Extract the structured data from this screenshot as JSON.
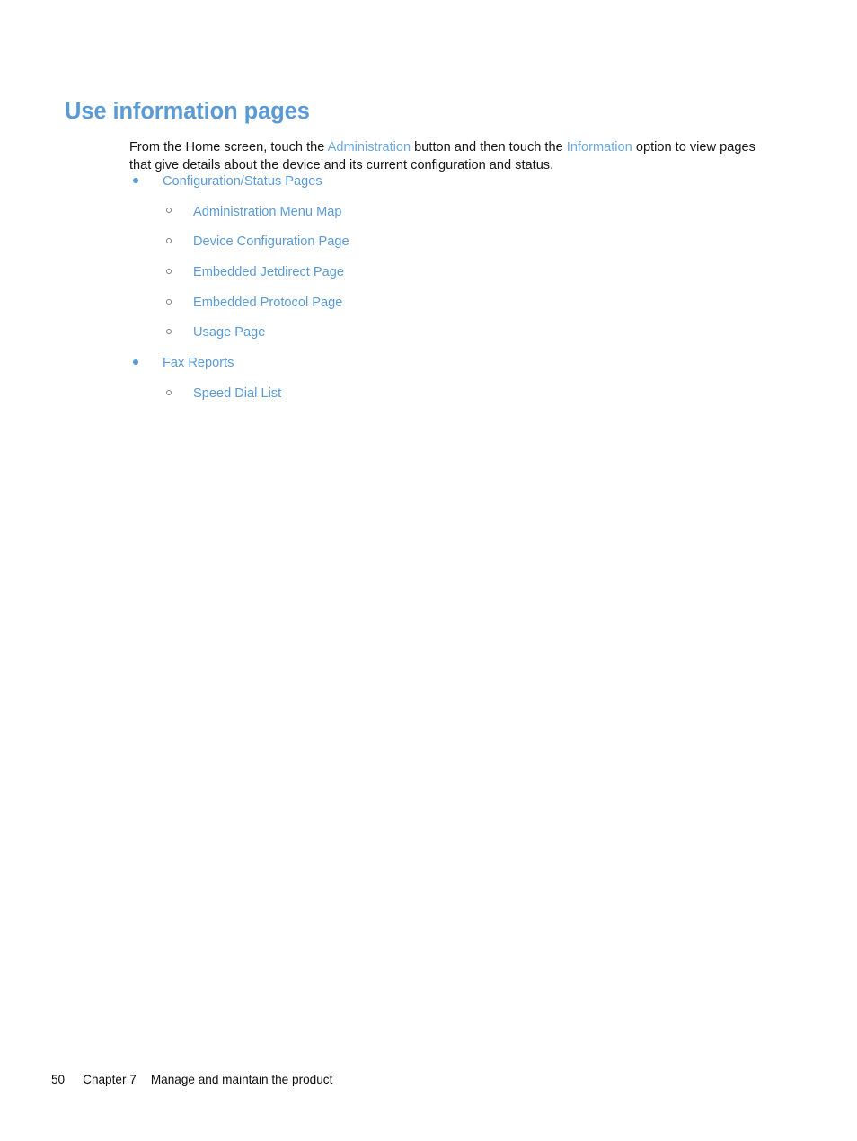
{
  "document": {
    "heading": "Use information pages",
    "intro": {
      "part1": "From the Home screen, touch the ",
      "link1": "Administration",
      "part2": " button and then touch the ",
      "link2": "Information",
      "part3": " option to view pages that give details about the device and its current configuration and status."
    },
    "colors": {
      "heading_blue": "#5b9bd5",
      "link_blue": "#5b9bd5",
      "inline_link_blue": "#6aa8dd",
      "body_text": "#151515",
      "page_background": "#ffffff"
    },
    "lists": [
      {
        "label": "Configuration/Status Pages",
        "marker": "disc-bullet-icon",
        "children": [
          {
            "label": "Administration Menu Map",
            "marker": "circle-bullet-icon"
          },
          {
            "label": "Device Configuration Page",
            "marker": "circle-bullet-icon"
          },
          {
            "label": "Embedded Jetdirect Page",
            "marker": "circle-bullet-icon"
          },
          {
            "label": "Embedded Protocol Page",
            "marker": "circle-bullet-icon"
          },
          {
            "label": "Usage Page",
            "marker": "circle-bullet-icon"
          }
        ]
      },
      {
        "label": "Fax Reports",
        "marker": "disc-bullet-icon",
        "children": [
          {
            "label": "Speed Dial List",
            "marker": "circle-bullet-icon"
          }
        ]
      }
    ],
    "footer": {
      "page_number": "50",
      "chapter": "Chapter 7",
      "title": "Manage and maintain the product"
    }
  }
}
